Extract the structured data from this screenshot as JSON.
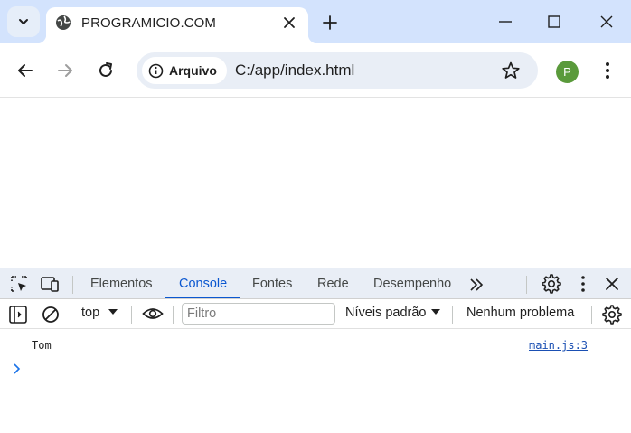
{
  "browser": {
    "tab": {
      "title": "PROGRAMICIO.COM"
    },
    "omnibox": {
      "chip_label": "Arquivo",
      "url": "C:/app/index.html"
    },
    "profile": {
      "initial": "P",
      "color": "#5a9a3b"
    }
  },
  "devtools": {
    "tabs": [
      {
        "label": "Elementos",
        "active": false
      },
      {
        "label": "Console",
        "active": true
      },
      {
        "label": "Fontes",
        "active": false
      },
      {
        "label": "Rede",
        "active": false
      },
      {
        "label": "Desempenho",
        "active": false
      }
    ],
    "toolbar": {
      "context": "top",
      "filter_placeholder": "Filtro",
      "levels": "Níveis padrão",
      "issues": "Nenhum problema"
    },
    "console": {
      "messages": [
        {
          "text": "Tom",
          "source": "main.js:3"
        }
      ]
    },
    "accent_color": "#0b57d0"
  },
  "icons": [
    "tab-search-icon",
    "globe-icon",
    "close-icon",
    "plus-icon",
    "minimize-icon",
    "maximize-icon",
    "back-arrow-icon",
    "forward-arrow-icon",
    "reload-icon",
    "info-icon",
    "star-icon",
    "more-vert-icon",
    "inspect-icon",
    "device-toolbar-icon",
    "chevron-double-right-icon",
    "gear-icon",
    "sidebar-icon",
    "clear-console-icon",
    "eye-icon",
    "chevron-right-icon"
  ]
}
